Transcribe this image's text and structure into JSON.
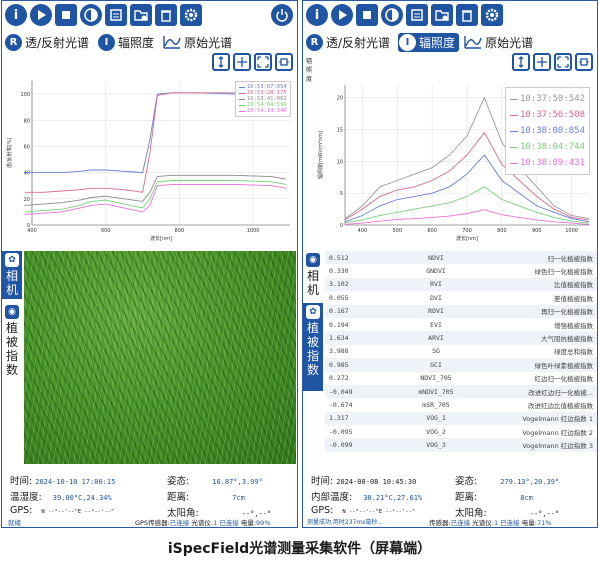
{
  "caption": "iSpecField光谱测量采集软件（屏幕端）",
  "toolbar_icons": [
    "info-icon",
    "play-icon",
    "stop-icon",
    "contrast-icon",
    "document-icon",
    "folder-add-icon",
    "trash-icon",
    "gear-icon",
    "power-icon"
  ],
  "left": {
    "tabs": [
      {
        "icon": "R",
        "label": "透/反射光谱",
        "active": false
      },
      {
        "icon": "I",
        "label": "辐照度",
        "active": false
      },
      {
        "icon": "wave",
        "label": "原始光谱",
        "active": false
      }
    ],
    "chart_data": {
      "type": "line",
      "xlabel": "波长[nm]",
      "ylabel": "透/反射率[%]",
      "xticks": [
        "400",
        "600",
        "800",
        "1000"
      ],
      "yticks": [
        "0",
        "20",
        "40",
        "60",
        "80",
        "100"
      ],
      "xlim": [
        400,
        1100
      ],
      "ylim": [
        0,
        110
      ],
      "series": [
        {
          "name": "16:53:07:054",
          "color": "#6a7fd8",
          "x": [
            380,
            430,
            480,
            530,
            560,
            600,
            650,
            700,
            720,
            740,
            780,
            850,
            950,
            1050,
            1090
          ],
          "y": [
            40,
            40,
            40,
            41,
            42,
            42,
            41,
            40,
            65,
            100,
            101,
            101,
            100,
            100,
            99
          ]
        },
        {
          "name": "16:53:28:175",
          "color": "#d86a8a",
          "x": [
            380,
            430,
            480,
            530,
            560,
            600,
            650,
            700,
            720,
            740,
            780,
            850,
            950,
            1050,
            1090
          ],
          "y": [
            25,
            25,
            26,
            27,
            28,
            28,
            27,
            25,
            55,
            99,
            101,
            101,
            101,
            100,
            100
          ]
        },
        {
          "name": "16:53:41:062",
          "color": "#8a8a8a",
          "x": [
            380,
            430,
            480,
            530,
            560,
            600,
            650,
            700,
            720,
            740,
            780,
            850,
            950,
            1050,
            1090
          ],
          "y": [
            15,
            16,
            17,
            19,
            21,
            22,
            20,
            18,
            25,
            37,
            38,
            38,
            38,
            37,
            35
          ]
        },
        {
          "name": "16:54:04:599",
          "color": "#7ccf7c",
          "x": [
            380,
            430,
            480,
            530,
            560,
            600,
            650,
            700,
            720,
            740,
            780,
            850,
            950,
            1050,
            1090
          ],
          "y": [
            10,
            11,
            12,
            15,
            18,
            19,
            16,
            13,
            20,
            33,
            34,
            34,
            34,
            33,
            31
          ]
        },
        {
          "name": "16:54:14:146",
          "color": "#e872d9",
          "x": [
            380,
            430,
            480,
            530,
            560,
            600,
            650,
            700,
            720,
            740,
            780,
            850,
            950,
            1050,
            1090
          ],
          "y": [
            8,
            9,
            10,
            13,
            15,
            16,
            13,
            10,
            15,
            30,
            31,
            31,
            31,
            30,
            28
          ]
        }
      ]
    },
    "side_tabs": [
      {
        "icon": "plant",
        "label": "相机",
        "active": true
      },
      {
        "icon": "circle",
        "label": "植被指数",
        "active": false
      }
    ],
    "info": {
      "time_label": "时间:",
      "time_value": "2024-10-10 17:00:15",
      "pose_label": "姿态:",
      "pose_value": "16.87°,3.99°",
      "humid_label": "温湿度:",
      "humid_value": "39.00°C,24.34%",
      "dist_label": "距离:",
      "dist_value": "7cm",
      "gps_label": "GPS:",
      "gps_value": "N --°--'--\"E --°--'--\"",
      "sun_label": "太阳角:",
      "sun_value": "--°,--°"
    },
    "status": {
      "state": "就绪",
      "gps_label": "GPS传感器:",
      "gps_value": "已连接",
      "spec_label": "光谱仪:",
      "spec_value": "1 已连接",
      "battery_label": "电量:",
      "battery_value": "99%"
    }
  },
  "right": {
    "tabs": [
      {
        "icon": "R",
        "label": "透/反射光谱",
        "active": false
      },
      {
        "icon": "I",
        "label": "辐照度",
        "active": true
      },
      {
        "icon": "wave",
        "label": "原始光谱",
        "active": false
      }
    ],
    "side_label_top": "辐照度",
    "chart_data": {
      "type": "line",
      "xlabel": "波长[nm]",
      "ylabel": "辐照度[mW/cm²nm]",
      "xticks": [
        "400",
        "500",
        "600",
        "700",
        "800",
        "900",
        "1000"
      ],
      "yticks": [
        "0",
        "5",
        "10",
        "15",
        "20"
      ],
      "xlim": [
        350,
        1050
      ],
      "ylim": [
        0,
        22
      ],
      "series": [
        {
          "name": "10:37:50:542",
          "color": "#9a9a9a",
          "x": [
            350,
            400,
            450,
            500,
            550,
            600,
            650,
            700,
            750,
            800,
            850,
            900,
            950,
            1000,
            1050
          ],
          "y": [
            1,
            3,
            6,
            7,
            8,
            9,
            11,
            14,
            20,
            13,
            9,
            6,
            3,
            1.5,
            1
          ]
        },
        {
          "name": "10:37:56:508",
          "color": "#d86a8a",
          "x": [
            350,
            400,
            450,
            500,
            550,
            600,
            650,
            700,
            750,
            800,
            850,
            900,
            950,
            1000,
            1050
          ],
          "y": [
            0.8,
            2.5,
            4.5,
            5.5,
            6,
            7,
            8.5,
            11,
            14.5,
            9.5,
            7,
            4.5,
            2.5,
            1.2,
            0.8
          ]
        },
        {
          "name": "10:38:00:854",
          "color": "#6a7fd8",
          "x": [
            350,
            400,
            450,
            500,
            550,
            600,
            650,
            700,
            750,
            800,
            850,
            900,
            950,
            1000,
            1050
          ],
          "y": [
            0.5,
            1.5,
            3,
            4,
            4.5,
            5,
            6,
            8,
            11,
            7,
            5,
            3,
            2,
            1,
            0.5
          ]
        },
        {
          "name": "10:38:04:744",
          "color": "#7ccf7c",
          "x": [
            350,
            400,
            450,
            500,
            550,
            600,
            650,
            700,
            750,
            800,
            850,
            900,
            950,
            1000,
            1050
          ],
          "y": [
            0.3,
            0.8,
            1.5,
            2,
            2.5,
            3,
            3.5,
            4.5,
            6,
            4,
            3,
            2,
            1.2,
            0.6,
            0.3
          ]
        },
        {
          "name": "10:38:09:431",
          "color": "#e872d9",
          "x": [
            350,
            400,
            450,
            500,
            550,
            600,
            650,
            700,
            750,
            800,
            850,
            900,
            950,
            1000,
            1050
          ],
          "y": [
            0.1,
            0.3,
            0.6,
            0.9,
            1,
            1.2,
            1.4,
            1.8,
            2.4,
            1.6,
            1.2,
            0.8,
            0.5,
            0.3,
            0.1
          ]
        }
      ]
    },
    "side_tabs": [
      {
        "icon": "circle",
        "label": "相机",
        "active": false
      },
      {
        "icon": "plant",
        "label": "植被指数",
        "active": true
      }
    ],
    "vi_rows": [
      [
        "0.512",
        "NDVI",
        "归一化植被指数"
      ],
      [
        "0.330",
        "GNDVI",
        "绿色归一化植被指数"
      ],
      [
        "3.102",
        "RVI",
        "比值植被指数"
      ],
      [
        "0.055",
        "DVI",
        "差值植被指数"
      ],
      [
        "0.167",
        "RDVI",
        "再归一化植被指数"
      ],
      [
        "0.194",
        "EVI",
        "增强植被指数"
      ],
      [
        "1.634",
        "ARVI",
        "大气阻抗植被指数"
      ],
      [
        "3.988",
        "SG",
        "绿度总和指数"
      ],
      [
        "0.985",
        "GCI",
        "绿色叶绿素植被指数"
      ],
      [
        "0.272",
        "NDVI_705",
        "红边归一化植被指数"
      ],
      [
        "-0.049",
        "mNDVI_705",
        "改进红边归一化植被..."
      ],
      [
        "-0.674",
        "mSR_705",
        "改进红边比值植被指数"
      ],
      [
        "1.317",
        "VOG_1",
        "Vogelmann 红边指数 1"
      ],
      [
        "-0.095",
        "VOG_2",
        "Vogelmann 红边指数 2"
      ],
      [
        "-0.099",
        "VOG_3",
        "Vogelmann 红边指数 3"
      ]
    ],
    "info": {
      "time_label": "时间:",
      "time_value": "2024-08-08 10:45:30",
      "pose_label": "姿态:",
      "pose_value": "279.13°,20.39°",
      "humid_label": "内部温度:",
      "humid_value": "38.21°C,27.61%",
      "dist_label": "距离:",
      "dist_value": "8cm",
      "gps_label": "GPS:",
      "gps_value": "N --°--'--\"E --°--'--\"",
      "sun_label": "太阳角:",
      "sun_value": "--°,--°"
    },
    "status": {
      "state": "测量成功,用时237ms毫秒...",
      "gps_label": "传感器:",
      "gps_value": "已连接",
      "spec_label": "光谱仪:",
      "spec_value": "1 已连接",
      "battery_label": "电量:",
      "battery_value": "71%"
    }
  }
}
